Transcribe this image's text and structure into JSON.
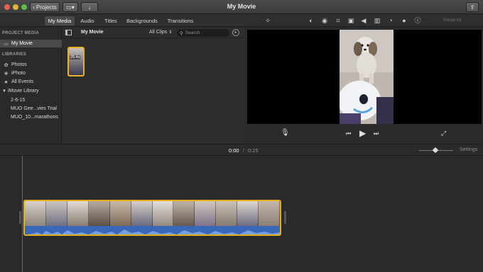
{
  "window": {
    "title": "My Movie",
    "projects_label": "Projects"
  },
  "tabs": [
    "My Media",
    "Audio",
    "Titles",
    "Backgrounds",
    "Transitions"
  ],
  "viewer_toolbar": {
    "reset_all": "Reset All"
  },
  "sidebar": {
    "project_media_header": "PROJECT MEDIA",
    "project_item": "My Movie",
    "libraries_header": "LIBRARIES",
    "library_items": [
      "Photos",
      "iPhoto",
      "All Events"
    ],
    "imovie_library": "iMovie Library",
    "events": [
      "2-6-15",
      "MUO Gee...vies Trial",
      "MUO_10...marathons"
    ]
  },
  "browser": {
    "title": "My Movie",
    "filter": "All Clips",
    "search_placeholder": "Search",
    "clip_duration": "25.4s"
  },
  "timeline": {
    "current_time": "0:00",
    "separator": "/",
    "total_time": "0:25",
    "settings_label": "Settings"
  },
  "colors": {
    "selection_yellow": "#e4ad1d",
    "audio_blue": "#3a68b8"
  }
}
